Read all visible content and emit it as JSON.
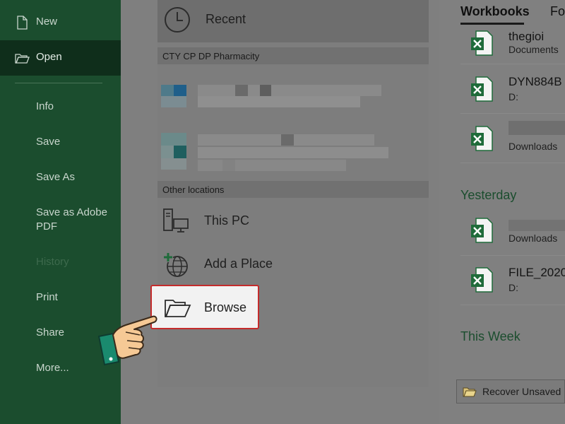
{
  "sidebar": {
    "items": [
      {
        "label": "New"
      },
      {
        "label": "Open"
      },
      {
        "label": "Info"
      },
      {
        "label": "Save"
      },
      {
        "label": "Save As"
      },
      {
        "label": "Save as Adobe PDF"
      },
      {
        "label": "History"
      },
      {
        "label": "Print"
      },
      {
        "label": "Share"
      },
      {
        "label": "More..."
      }
    ],
    "active_item": "Open",
    "disabled_item": "History"
  },
  "locations": {
    "recent_label": "Recent",
    "account_header": "CTY CP DP Pharmacity",
    "other_header": "Other locations",
    "this_pc": "This PC",
    "add_place": "Add a Place",
    "browse": "Browse"
  },
  "workbooks": {
    "tabs": [
      "Workbooks",
      "Fo"
    ],
    "groups": [
      {
        "label": "Yesterday"
      },
      {
        "label": "This Week"
      }
    ],
    "items": [
      {
        "name": "thegioi",
        "location": "Documents"
      },
      {
        "name": "DYN884B",
        "location": "D:"
      },
      {
        "name": "",
        "location": "Downloads"
      },
      {
        "name": "",
        "location": "Downloads"
      },
      {
        "name": "FILE_2020",
        "location": "D:"
      }
    ],
    "recover_label": "Recover Unsaved"
  },
  "colors": {
    "sidebar_bg": "#1b4d2e",
    "accent_green": "#1b4d2e",
    "excel_green": "#1f6b3a",
    "highlight_border": "#c42b2b"
  }
}
